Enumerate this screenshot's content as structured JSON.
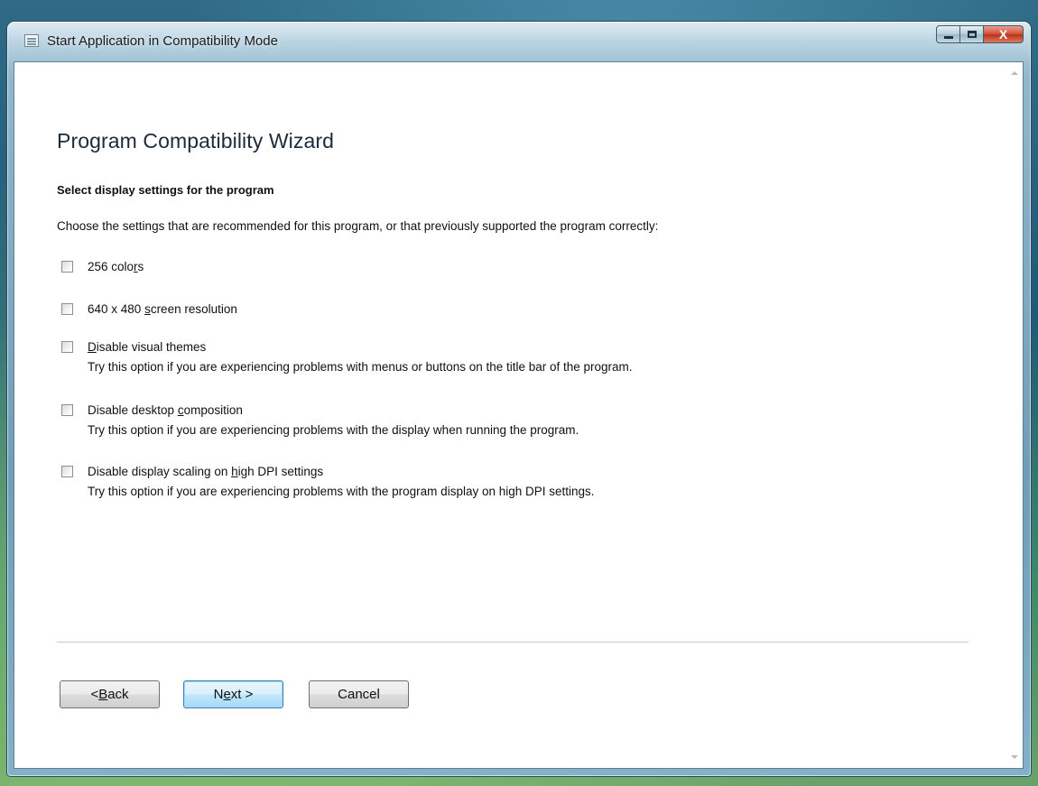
{
  "window": {
    "title": "Start Application in Compatibility Mode",
    "controls": {
      "minimize": "minimize",
      "maximize": "maximize",
      "close": "X"
    }
  },
  "wizard": {
    "heading": "Program Compatibility Wizard",
    "section_title": "Select display settings for the program",
    "intro": "Choose the settings that are recommended for this program, or that previously supported the program correctly:"
  },
  "options": [
    {
      "pre": "256 colo",
      "key": "r",
      "post": "s",
      "description": "",
      "checked": false
    },
    {
      "pre": "640 x 480 ",
      "key": "s",
      "post": "creen resolution",
      "description": "",
      "checked": false
    },
    {
      "pre": "",
      "key": "D",
      "post": "isable visual themes",
      "description": "Try this option if you are experiencing problems with menus or buttons on the title bar of the program.",
      "checked": false
    },
    {
      "pre": "Disable desktop ",
      "key": "c",
      "post": "omposition",
      "description": "Try this option if you are experiencing problems with the display when running the program.",
      "checked": false
    },
    {
      "pre": "Disable display scaling on ",
      "key": "h",
      "post": "igh DPI settings",
      "description": "Try this option if you are experiencing problems with the program display on high DPI settings.",
      "checked": false
    }
  ],
  "buttons": {
    "back": {
      "pre": "< ",
      "key": "B",
      "post": "ack"
    },
    "next": {
      "pre": "N",
      "key": "e",
      "post": "xt >"
    },
    "cancel": {
      "pre": "Cancel",
      "key": "",
      "post": ""
    }
  },
  "icons": {
    "app": "window-list-icon",
    "scroll_up": "scroll-up-arrow-icon",
    "scroll_down": "scroll-down-arrow-icon"
  }
}
